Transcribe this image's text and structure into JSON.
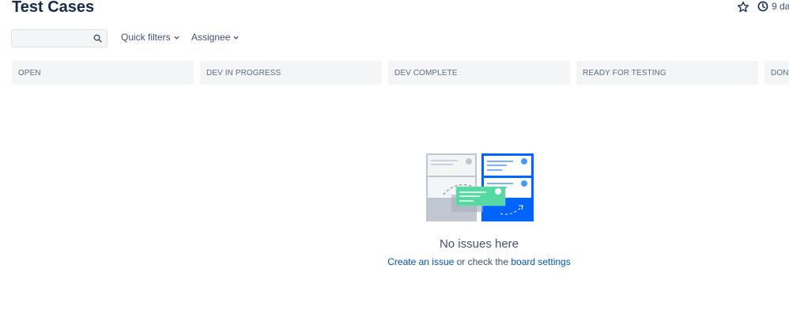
{
  "header": {
    "title": "Test Cases",
    "history_label": "9 da"
  },
  "toolbar": {
    "search_value": "",
    "search_placeholder": "",
    "quick_filters_label": "Quick filters",
    "assignee_label": "Assignee"
  },
  "columns": [
    {
      "label": "OPEN"
    },
    {
      "label": "DEV IN PROGRESS"
    },
    {
      "label": "DEV COMPLETE"
    },
    {
      "label": "READY FOR TESTING"
    },
    {
      "label": "DONE"
    }
  ],
  "empty_state": {
    "title": "No issues here",
    "create_link": "Create an issue",
    "middle_text": " or check the ",
    "settings_link": "board settings"
  },
  "icons": {
    "star": "star-outline-icon",
    "history": "clock-icon",
    "search": "search-icon",
    "chevron": "chevron-down-icon"
  },
  "colors": {
    "link": "#0052cc",
    "column_bg": "#f4f5f7",
    "brand_blue": "#0065ff",
    "card_green": "#57d9a3"
  }
}
